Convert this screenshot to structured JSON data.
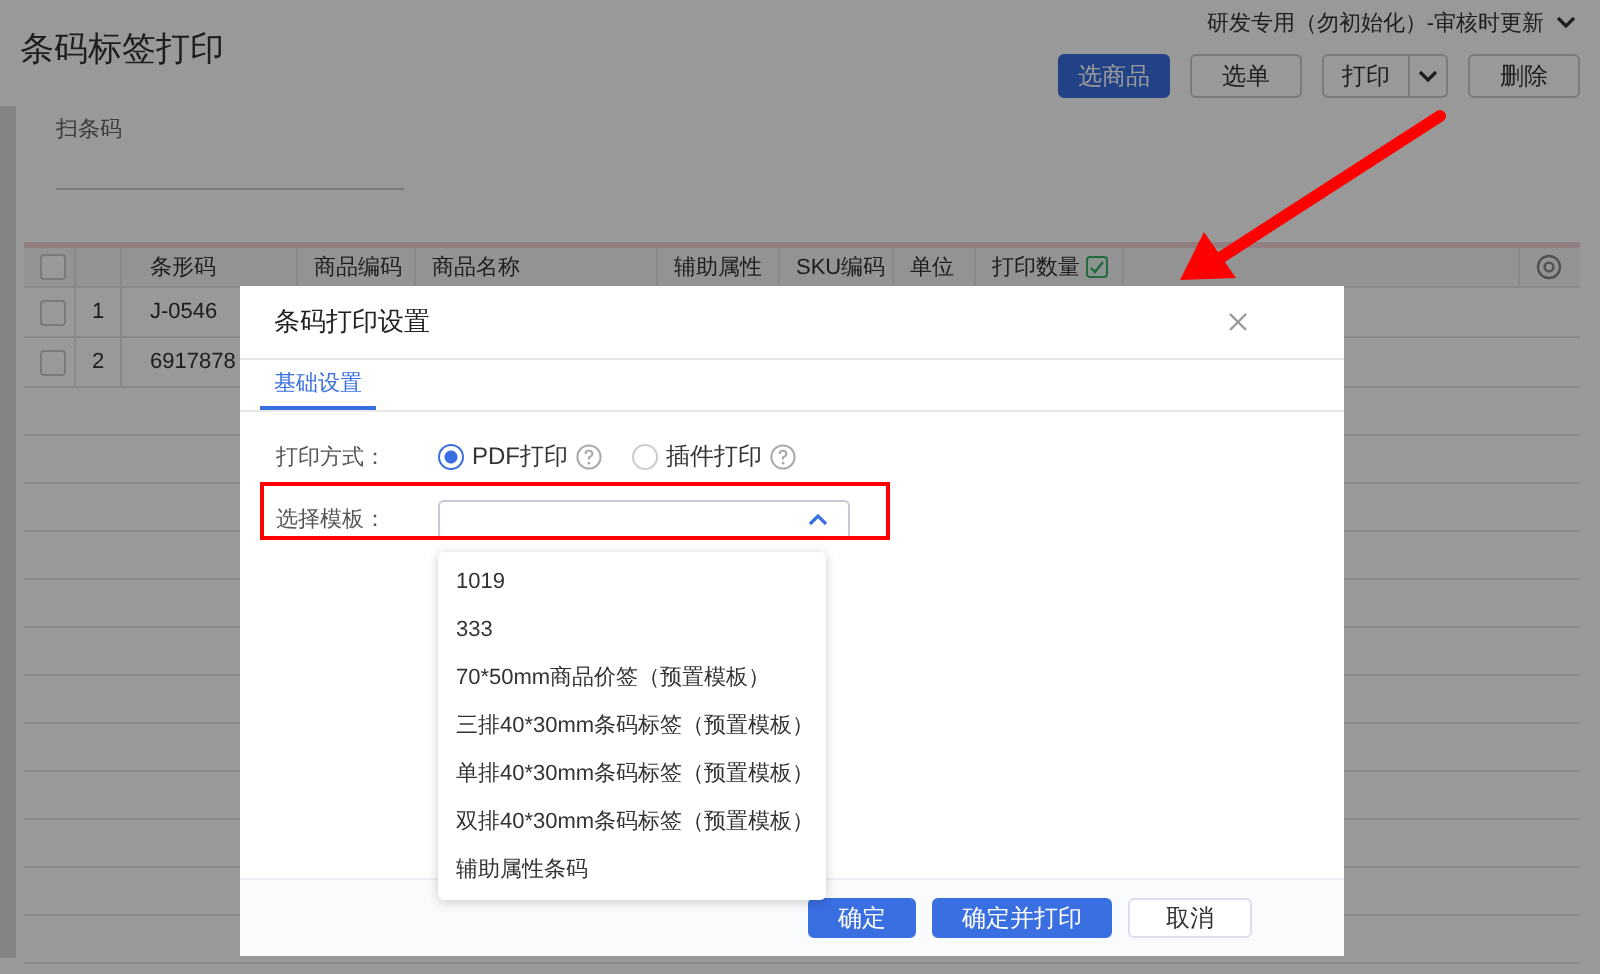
{
  "page": {
    "title": "条码标签打印",
    "org_selector": "研发专用（勿初始化）-审核时更新",
    "buttons": [
      {
        "label": "选商品",
        "kind": "primary"
      },
      {
        "label": "选单",
        "kind": "default"
      },
      {
        "label": "打印",
        "kind": "split"
      },
      {
        "label": "删除",
        "kind": "default"
      }
    ],
    "scan_field": {
      "label": "扫条码"
    }
  },
  "table": {
    "select_all_checked": false,
    "columns": [
      "条形码",
      "商品编码",
      "商品名称",
      "辅助属性",
      "SKU编码",
      "单位",
      "打印数量"
    ],
    "rows": [
      {
        "checked": false,
        "index": "1",
        "barcode": "J-0546"
      },
      {
        "checked": false,
        "index": "2",
        "barcode": "6917878"
      }
    ]
  },
  "dialog": {
    "title": "条码打印设置",
    "tabs": [
      {
        "label": "基础设置",
        "selected": true
      }
    ],
    "print_method": {
      "label": "打印方式：",
      "options": [
        {
          "label": "PDF打印",
          "selected": true
        },
        {
          "label": "插件打印",
          "selected": false
        }
      ]
    },
    "template": {
      "label": "选择模板：",
      "expanded": true,
      "options": [
        "1019",
        "333",
        "70*50mm商品价签（预置模板）",
        "三排40*30mm条码标签（预置模板）",
        "单排40*30mm条码标签（预置模板）",
        "双排40*30mm条码标签（预置模板）",
        "辅助属性条码"
      ]
    },
    "buttons": [
      {
        "label": "确定",
        "kind": "primary"
      },
      {
        "label": "确定并打印",
        "kind": "primary"
      },
      {
        "label": "取消",
        "kind": "default"
      }
    ]
  }
}
